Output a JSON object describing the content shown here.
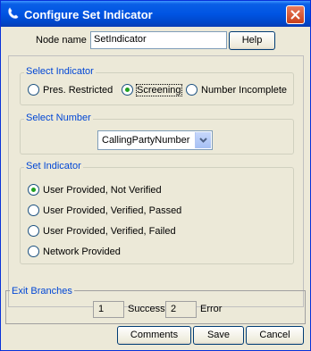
{
  "window": {
    "title": "Configure Set Indicator"
  },
  "node": {
    "label": "Node name",
    "value": "SetIndicator",
    "help_label": "Help"
  },
  "select_indicator": {
    "legend": "Select Indicator",
    "options": [
      "Pres. Restricted",
      "Screening",
      "Number Incomplete"
    ],
    "selected": "Screening"
  },
  "select_number": {
    "legend": "Select Number",
    "value": "CallingPartyNumber"
  },
  "set_indicator": {
    "legend": "Set Indicator",
    "options": [
      "User Provided, Not Verified",
      "User Provided, Verified, Passed",
      "User Provided, Verified, Failed",
      "Network Provided"
    ],
    "selected": "User Provided, Not Verified"
  },
  "exit_branches": {
    "legend": "Exit Branches",
    "success_num": "1",
    "success_label": "Success",
    "error_num": "2",
    "error_label": "Error"
  },
  "footer": {
    "comments_label": "Comments",
    "save_label": "Save",
    "cancel_label": "Cancel"
  },
  "icons": {
    "title": "phone-handset-icon",
    "close": "close-icon",
    "dropdown": "chevron-down-icon"
  }
}
